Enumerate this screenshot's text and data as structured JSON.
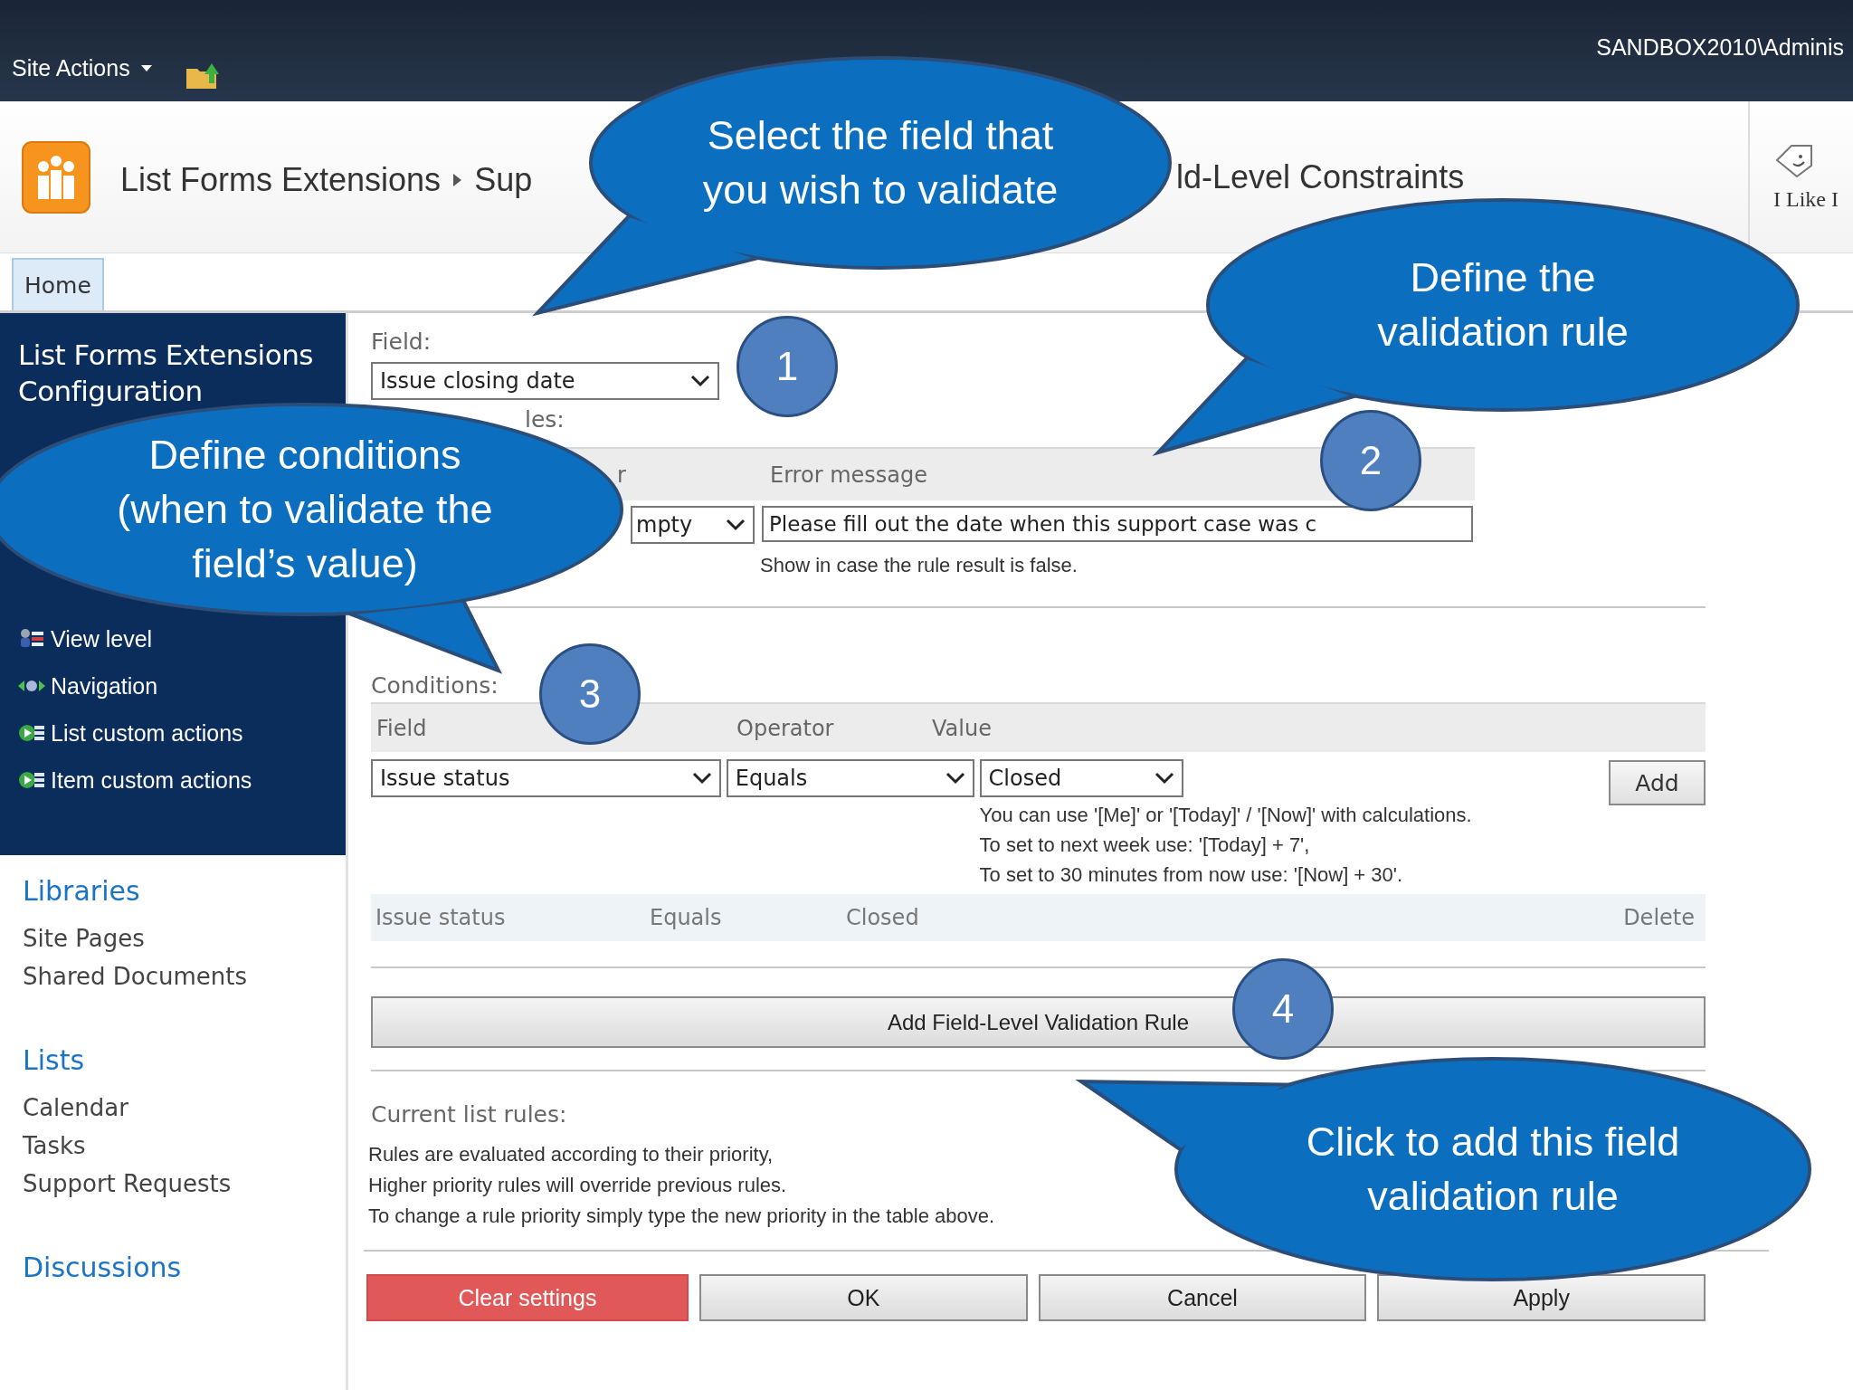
{
  "top_bar": {
    "site_actions": "Site Actions",
    "user": "SANDBOX2010\\Adminis"
  },
  "title_bar": {
    "breadcrumb": "List Forms Extensions",
    "breadcrumb_next": "Sup",
    "breadcrumb_tail": "ld-Level Constraints",
    "like_label": "I Like I"
  },
  "tabs": [
    {
      "label": "Home",
      "selected": true
    }
  ],
  "sidebar": {
    "heading": "List Forms Extensions Configuration",
    "items": [
      {
        "label": "View level",
        "kind": "permissions"
      },
      {
        "label": "Navigation",
        "kind": "navigation"
      },
      {
        "label": "List custom actions",
        "kind": "action"
      },
      {
        "label": "Item custom actions",
        "kind": "action"
      }
    ],
    "groups": [
      {
        "title": "Libraries",
        "links": [
          "Site Pages",
          "Shared Documents"
        ]
      },
      {
        "title": "Lists",
        "links": [
          "Calendar",
          "Tasks",
          "Support Requests"
        ]
      },
      {
        "title": "Discussions"
      }
    ]
  },
  "field": {
    "label": "Field:",
    "value": "Issue closing date"
  },
  "field_rules": {
    "label_fragment": "les:",
    "column_1": "r",
    "column_2": "Error message",
    "operator_fragment": "mpty",
    "error_message": "Please fill out the date when this support case was c",
    "hint": "Show in case the rule result is false."
  },
  "conditions": {
    "label": "Conditions:",
    "columns": [
      "Field",
      "Operator",
      "Value"
    ],
    "field": "Issue status",
    "operator": "Equals",
    "value": "Closed",
    "add": "Add",
    "hints": [
      "You can use '[Me]' or '[Today]' / '[Now]' with calculations.",
      "To set to next week use: '[Today] + 7',",
      "To set to 30 minutes from now use: '[Now] + 30'."
    ],
    "rows": [
      {
        "field": "Issue status",
        "operator": "Equals",
        "value": "Closed",
        "action": "Delete"
      }
    ]
  },
  "add_rule_button": "Add Field-Level Validation Rule",
  "current_rules": {
    "label": "Current list rules:",
    "lines": [
      "Rules are evaluated according to their priority,",
      "Higher priority rules will override previous rules.",
      "To change a rule priority simply type the new priority in the table above."
    ]
  },
  "buttons": [
    {
      "label": "Clear settings",
      "kind": "danger"
    },
    {
      "label": "OK",
      "kind": "normal"
    },
    {
      "label": "Cancel",
      "kind": "normal"
    },
    {
      "label": "Apply",
      "kind": "normal"
    }
  ],
  "callouts": [
    {
      "lines": [
        "Select the field that",
        "you wish to validate"
      ]
    },
    {
      "lines": [
        "Define the",
        "validation rule"
      ]
    },
    {
      "lines": [
        "Define conditions",
        "(when to validate the",
        "field’s value)"
      ]
    },
    {
      "lines": [
        "Click to add this field",
        "validation rule"
      ]
    }
  ],
  "steps": [
    "1",
    "2",
    "3",
    "4"
  ]
}
